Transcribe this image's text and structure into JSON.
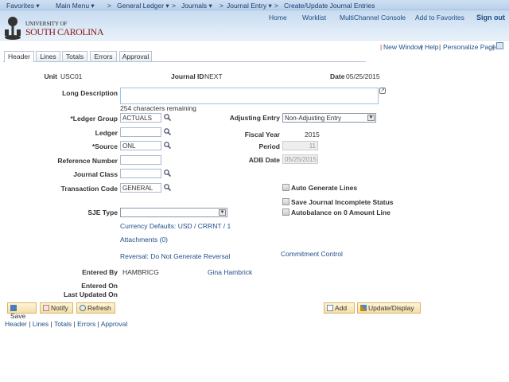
{
  "nav": {
    "favorites": "Favorites ▾",
    "main_menu": "Main Menu ▾",
    "general_ledger": "General Ledger ▾",
    "journals": "Journals ▾",
    "journal_entry": "Journal Entry ▾",
    "current": "Create/Update Journal Entries",
    "sep": ">"
  },
  "header_links": {
    "home": "Home",
    "worklist": "Worklist",
    "multichannel": "MultiChannel Console",
    "add_favorites": "Add to Favorites",
    "sign_out": "Sign out"
  },
  "logo": {
    "line1": "UNIVERSITY OF",
    "line2": "SOUTH CAROLINA"
  },
  "page_links": {
    "new_window": "New Window",
    "help": "Help",
    "personalize": "Personalize Page"
  },
  "tabs": [
    "Header",
    "Lines",
    "Totals",
    "Errors",
    "Approval"
  ],
  "form": {
    "unit_label": "Unit",
    "unit": "USC01",
    "journal_id_label": "Journal ID",
    "journal_id": "NEXT",
    "date_label": "Date",
    "date": "05/25/2015",
    "long_desc_label": "Long Description",
    "long_desc": "",
    "chars_remaining": "254 characters remaining",
    "ledger_group_label": "*Ledger Group",
    "ledger_group": "ACTUALS",
    "ledger_label": "Ledger",
    "ledger": "",
    "source_label": "*Source",
    "source": "ONL",
    "reference_label": "Reference Number",
    "reference": "",
    "journal_class_label": "Journal Class",
    "journal_class": "",
    "transaction_code_label": "Transaction Code",
    "transaction_code": "GENERAL",
    "sje_type_label": "SJE Type",
    "sje_type": "",
    "adjusting_label": "Adjusting Entry",
    "adjusting": "Non-Adjusting Entry",
    "fiscal_year_label": "Fiscal Year",
    "fiscal_year": "2015",
    "period_label": "Period",
    "period": "11",
    "adb_label": "ADB Date",
    "adb": "05/25/2015",
    "auto_generate": "Auto Generate Lines",
    "save_incomplete": "Save Journal Incomplete Status",
    "autobalance": "Autobalance on 0 Amount Line",
    "currency": "Currency Defaults: USD / CRRNT / 1",
    "attachments": "Attachments (0)",
    "reversal": "Reversal: Do Not Generate Reversal",
    "commitment": "Commitment Control",
    "entered_by_label": "Entered By",
    "entered_by": "HAMBRICG",
    "entered_by_name": "Gina Hambrick",
    "entered_on_label": "Entered On",
    "last_updated_label": "Last Updated On"
  },
  "buttons": {
    "save": "Save",
    "notify": "Notify",
    "refresh": "Refresh",
    "add": "Add",
    "update": "Update/Display"
  },
  "bottom_links": [
    "Header",
    "Lines",
    "Totals",
    "Errors",
    "Approval"
  ],
  "colors": {
    "link": "#1f4f8c",
    "brand": "#8b1a1a",
    "button": "#f4dfa8"
  }
}
